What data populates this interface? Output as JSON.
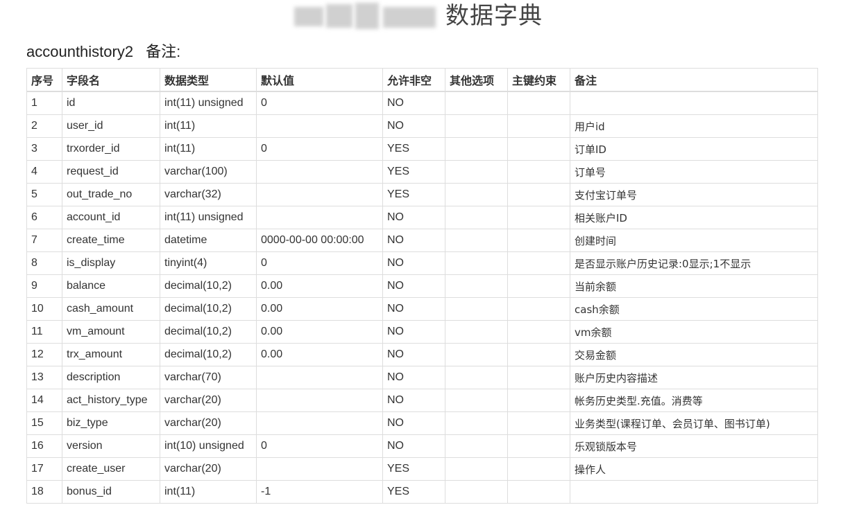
{
  "header": {
    "title": "数据字典"
  },
  "table_meta": {
    "name": "accounthistory2",
    "remark_label": "备注:"
  },
  "columns": [
    "序号",
    "字段名",
    "数据类型",
    "默认值",
    "允许非空",
    "其他选项",
    "主键约束",
    "备注"
  ],
  "rows": [
    [
      "1",
      "id",
      "int(11) unsigned",
      "0",
      "NO",
      "",
      "",
      ""
    ],
    [
      "2",
      "user_id",
      "int(11)",
      "",
      "NO",
      "",
      "",
      "用户id"
    ],
    [
      "3",
      "trxorder_id",
      "int(11)",
      "0",
      "YES",
      "",
      "",
      "订单ID"
    ],
    [
      "4",
      "request_id",
      "varchar(100)",
      "",
      "YES",
      "",
      "",
      "订单号"
    ],
    [
      "5",
      "out_trade_no",
      "varchar(32)",
      "",
      "YES",
      "",
      "",
      "支付宝订单号"
    ],
    [
      "6",
      "account_id",
      "int(11) unsigned",
      "",
      "NO",
      "",
      "",
      "相关账户ID"
    ],
    [
      "7",
      "create_time",
      "datetime",
      "0000-00-00 00:00:00",
      "NO",
      "",
      "",
      "创建时间"
    ],
    [
      "8",
      "is_display",
      "tinyint(4)",
      "0",
      "NO",
      "",
      "",
      "是否显示账户历史记录:0显示;1不显示"
    ],
    [
      "9",
      "balance",
      "decimal(10,2)",
      "0.00",
      "NO",
      "",
      "",
      "当前余额"
    ],
    [
      "10",
      "cash_amount",
      "decimal(10,2)",
      "0.00",
      "NO",
      "",
      "",
      "cash余额"
    ],
    [
      "11",
      "vm_amount",
      "decimal(10,2)",
      "0.00",
      "NO",
      "",
      "",
      "vm余额"
    ],
    [
      "12",
      "trx_amount",
      "decimal(10,2)",
      "0.00",
      "NO",
      "",
      "",
      "交易金额"
    ],
    [
      "13",
      "description",
      "varchar(70)",
      "",
      "NO",
      "",
      "",
      "账户历史内容描述"
    ],
    [
      "14",
      "act_history_type",
      "varchar(20)",
      "",
      "NO",
      "",
      "",
      "帐务历史类型.充值。消费等"
    ],
    [
      "15",
      "biz_type",
      "varchar(20)",
      "",
      "NO",
      "",
      "",
      "业务类型(课程订单、会员订单、图书订单)"
    ],
    [
      "16",
      "version",
      "int(10) unsigned",
      "0",
      "NO",
      "",
      "",
      "乐观锁版本号"
    ],
    [
      "17",
      "create_user",
      "varchar(20)",
      "",
      "YES",
      "",
      "",
      "操作人"
    ],
    [
      "18",
      "bonus_id",
      "int(11)",
      "-1",
      "YES",
      "",
      "",
      ""
    ]
  ]
}
